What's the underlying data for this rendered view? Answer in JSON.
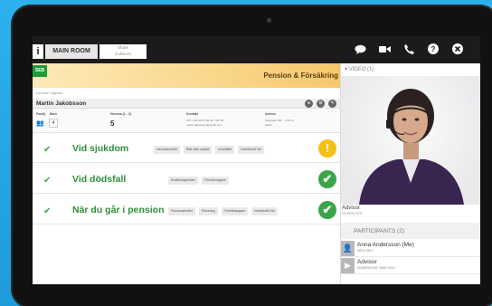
{
  "topbar": {
    "logo": "i",
    "main_room": "MAIN ROOM",
    "share_line1": "Share",
    "share_line2": "(Advisor)",
    "icons": [
      "chat-icon",
      "video-camera-icon",
      "phone-icon",
      "help-icon",
      "close-icon"
    ]
  },
  "header": {
    "logo": "SEB",
    "title": "Pension & Försäkring",
    "breadcrumb": "Lär kunn › Agenda"
  },
  "person": {
    "name": "Martin Jakobsson",
    "familj_label": "Familj",
    "barn_label": "Barn",
    "barn_value": "4",
    "kids_label": "Hemma (1 - 3)",
    "kids_value": "5",
    "kontakt_label": "Kontakt",
    "kontakt_value": "070 - 123 45 67 89 08 · 987 65",
    "kontakt_email": "martin.jakobsson@gmail.com",
    "adress_label": "Adress",
    "adress_value": "Storgatan 18b · 1 40 20",
    "adress_city": "Gävle"
  },
  "rows": [
    {
      "title": "Vid sjukdom",
      "chips": [
        "Inkomstbortfall",
        "Rätt vård snabbt",
        "Invaliditet",
        "Individuellt Val"
      ],
      "status": "!"
    },
    {
      "title": "Vid dödsfall",
      "chips": [
        "Ersättningsnivåer",
        "Förmånstagare"
      ],
      "status": "✔"
    },
    {
      "title": "När du går i pension",
      "chips": [
        "Pensionsnivåer",
        "Placering",
        "Förmånstagare",
        "Individuellt Val"
      ],
      "status": "✔"
    }
  ],
  "video": {
    "header": "VIDEO (1)",
    "caption_name": "Advisor",
    "caption_role": "MODERATOR"
  },
  "participants": {
    "header": "PARTICIPANTS (2)",
    "list": [
      {
        "name": "Anna Andersson (Me)",
        "role": "WEB ONLY"
      },
      {
        "name": "Advisor",
        "role": "MODERATOR, WEB ONLY"
      }
    ]
  },
  "colors": {
    "accent_green": "#2f8f3a",
    "warn_yellow": "#f4c015",
    "ok_green": "#3aa548",
    "background_blue": "#25a9e8"
  }
}
